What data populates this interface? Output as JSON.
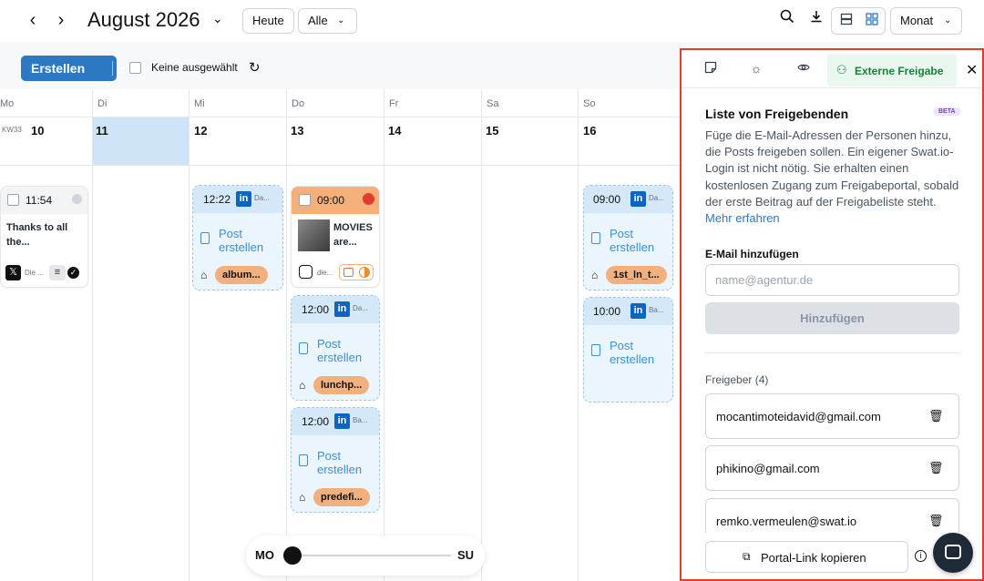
{
  "header": {
    "prev_icon": "chevron-left",
    "next_icon": "chevron-right",
    "month_title": "August 2026",
    "today_label": "Heute",
    "filter_label": "Alle",
    "view_label": "Monat"
  },
  "toolbar": {
    "create_label": "Erstellen",
    "selection_label": "Keine ausgewählt"
  },
  "calendar": {
    "week_label": "KW33",
    "days": [
      {
        "name": "Mo",
        "num": "10"
      },
      {
        "name": "Di",
        "num": "11"
      },
      {
        "name": "Mi",
        "num": "12"
      },
      {
        "name": "Do",
        "num": "13"
      },
      {
        "name": "Fr",
        "num": "14"
      },
      {
        "name": "Sa",
        "num": "15"
      },
      {
        "name": "So",
        "num": "16"
      }
    ],
    "post_create_line1": "Post",
    "post_create_line2": "erstellen",
    "mo_card": {
      "time": "11:54",
      "title_line1": "Thanks to all",
      "title_line2": "the...",
      "footer": "Die ..."
    },
    "mi_card": {
      "time": "12:22",
      "trunc": "Da...",
      "tag": "album..."
    },
    "do_card1": {
      "time": "09:00",
      "title_line1": "MOVIES",
      "title_line2": "are...",
      "footer": "die..."
    },
    "do_card2": {
      "time": "12:00",
      "trunc": "Da...",
      "tag": "lunchp..."
    },
    "do_card3": {
      "time": "12:00",
      "trunc": "Ba...",
      "tag": "predefi..."
    },
    "so_card1": {
      "time": "09:00",
      "trunc": "Da...",
      "tag": "1st_ln_t..."
    },
    "so_card2": {
      "time": "10:00",
      "trunc": "Ba..."
    }
  },
  "slider": {
    "left_label": "MO",
    "right_label": "SU",
    "position": 0
  },
  "panel": {
    "tab_active_label": "Externe Freigabe",
    "title": "Liste von Freigebenden",
    "beta": "BETA",
    "description": "Füge die E-Mail-Adressen der Personen hinzu, die Posts freigeben sollen. Ein eigener Swat.io-Login ist nicht nötig. Sie erhalten einen kostenlosen Zugang zum Freigabeportal, sobald der erste Beitrag auf der Freigabeliste steht.",
    "learn_more": "Mehr erfahren",
    "email_label": "E-Mail hinzufügen",
    "email_placeholder": "name@agentur.de",
    "add_button": "Hinzufügen",
    "approvers_label": "Freigeber (4)",
    "approvers": [
      "mocantimoteidavid@gmail.com",
      "phikino@gmail.com",
      "remko.vermeulen@swat.io"
    ],
    "copy_button": "Portal-Link kopieren"
  },
  "colors": {
    "accent": "#2d78c2",
    "panel_border": "#e03c2f",
    "tag": "#f2b07f",
    "linkedin": "#0a66c2",
    "active_tab": "#16803c"
  }
}
